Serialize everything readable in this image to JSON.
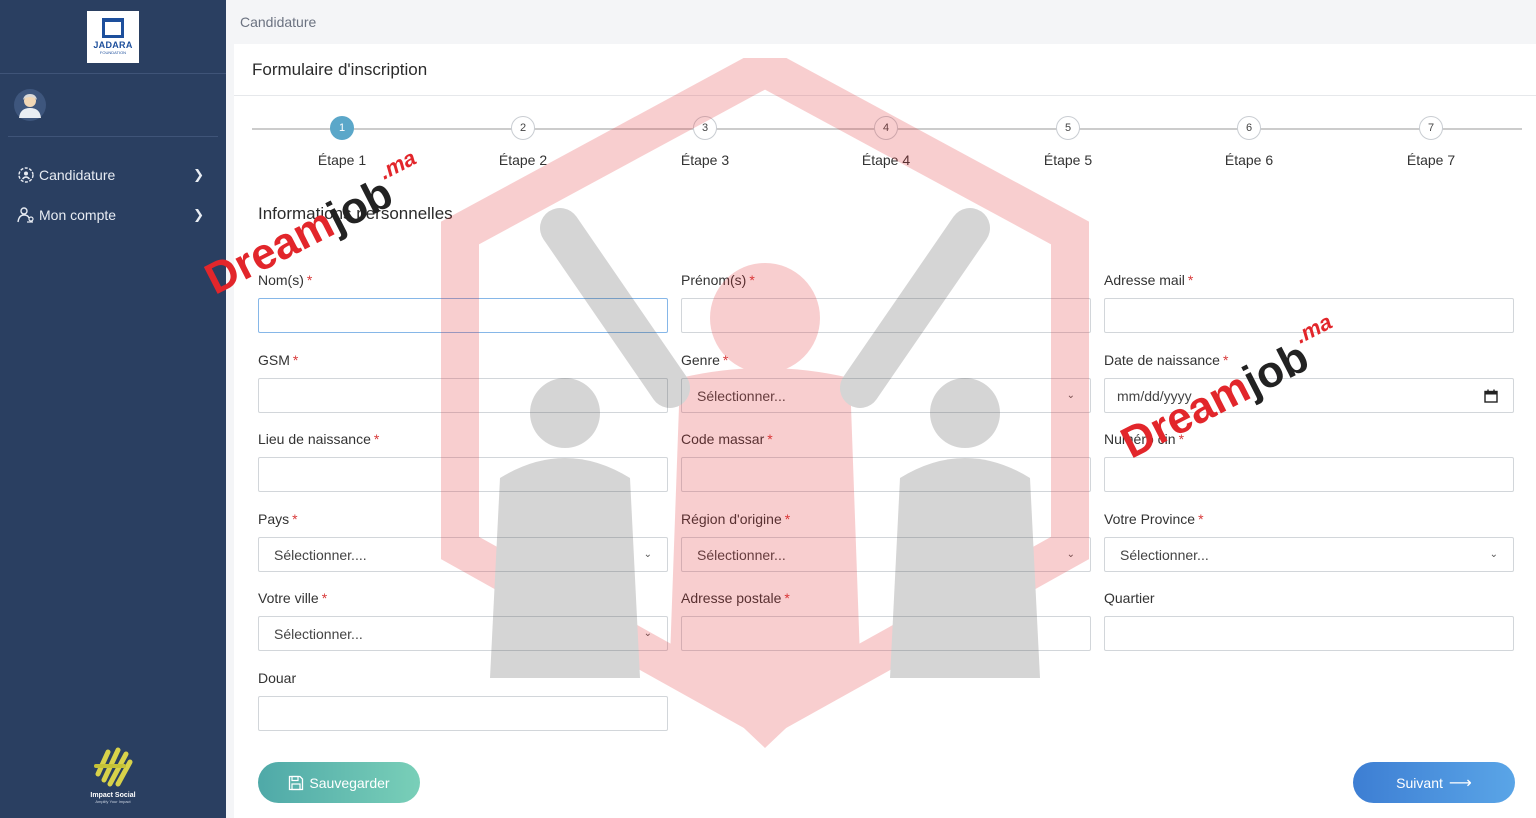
{
  "sidebar": {
    "logo": {
      "name": "JADARA",
      "sub": "FOUNDATION"
    },
    "nav": [
      {
        "label": "Candidature",
        "icon": "gear-user-icon"
      },
      {
        "label": "Mon compte",
        "icon": "user-key-icon"
      }
    ],
    "footer": {
      "name": "Impact Social",
      "tagline": "Amplify Your Impact"
    }
  },
  "header": {
    "breadcrumb": "Candidature"
  },
  "card": {
    "title": "Formulaire d'inscription"
  },
  "stepper": {
    "active": 1,
    "steps": [
      {
        "num": "1",
        "label": "Étape 1"
      },
      {
        "num": "2",
        "label": "Étape 2"
      },
      {
        "num": "3",
        "label": "Étape 3"
      },
      {
        "num": "4",
        "label": "Étape 4"
      },
      {
        "num": "5",
        "label": "Étape 5"
      },
      {
        "num": "6",
        "label": "Étape 6"
      },
      {
        "num": "7",
        "label": "Étape 7"
      }
    ]
  },
  "section": {
    "title": "Informations personnelles"
  },
  "form": {
    "nom": {
      "label": "Nom(s)",
      "value": ""
    },
    "prenom": {
      "label": "Prénom(s)",
      "value": ""
    },
    "email": {
      "label": "Adresse mail",
      "value": ""
    },
    "gsm": {
      "label": "GSM",
      "value": ""
    },
    "genre": {
      "label": "Genre",
      "value": "Sélectionner..."
    },
    "date_naissance": {
      "label": "Date de naissance",
      "placeholder": "mm/dd/yyyy"
    },
    "lieu_naissance": {
      "label": "Lieu de naissance",
      "value": ""
    },
    "code_massar": {
      "label": "Code massar",
      "value": ""
    },
    "cin": {
      "label": "Numéro cin",
      "value": ""
    },
    "pays": {
      "label": "Pays",
      "value": "Sélectionner...."
    },
    "region": {
      "label": "Région d'origine",
      "value": "Sélectionner..."
    },
    "province": {
      "label": "Votre Province",
      "value": "Sélectionner..."
    },
    "ville": {
      "label": "Votre ville",
      "value": "Sélectionner..."
    },
    "adresse": {
      "label": "Adresse postale",
      "value": ""
    },
    "quartier": {
      "label": "Quartier",
      "value": ""
    },
    "douar": {
      "label": "Douar",
      "value": ""
    }
  },
  "actions": {
    "save": "Sauvegarder",
    "next": "Suivant"
  },
  "watermark": {
    "part1": "Dream",
    "part2": "job",
    "part3": ".ma"
  },
  "colors": {
    "sidebar": "#2a3f61",
    "active_step": "#5ba7c9",
    "required": "#d83a3a",
    "save_btn": "#5ab5ac",
    "next_btn": "#4a90dc"
  }
}
